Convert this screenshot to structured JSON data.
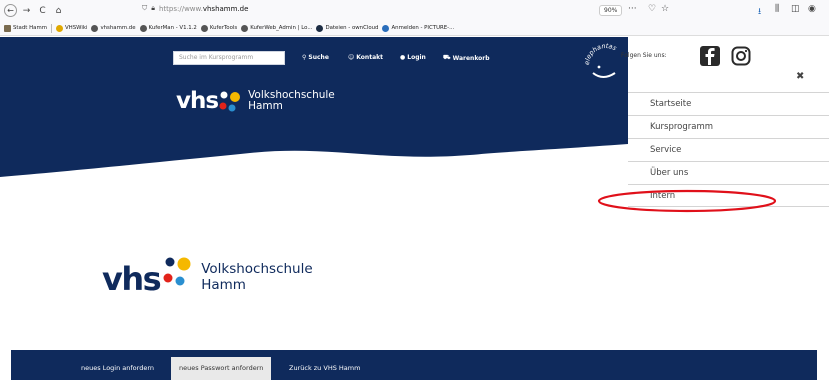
{
  "browser": {
    "url_prefix": "https://www.",
    "url_domain": "vhshamm.de",
    "zoom": "90%",
    "more": "···",
    "bookmarks": [
      {
        "label": "Stadt Hamm",
        "color": "#7a6b4f"
      },
      {
        "label": "VHSWiki",
        "color": "#e0a800"
      },
      {
        "label": "vhshamm.de",
        "color": "#555"
      },
      {
        "label": "KuferMan - V1.1.2",
        "color": "#555"
      },
      {
        "label": "KuferTools",
        "color": "#555"
      },
      {
        "label": "KuferWeb_Admin | Lo...",
        "color": "#555"
      },
      {
        "label": "Dateien - ownCloud",
        "color": "#1d2d44"
      },
      {
        "label": "Anmelden - PICTURE-...",
        "color": "#2a6ebb"
      }
    ]
  },
  "header": {
    "search_placeholder": "Suche im Kursprogramm",
    "nav": {
      "suche": "Suche",
      "kontakt": "Kontakt",
      "login": "Login",
      "warenkorb": "Warenkorb"
    },
    "logo_vhs": "vhs",
    "logo_line1": "Volkshochschule",
    "logo_line2": "Hamm",
    "elephant_text": "elephantas"
  },
  "panel": {
    "follow_label": "Folgen Sie uns:",
    "menu": [
      "Startseite",
      "Kursprogramm",
      "Service",
      "Über uns",
      "Intern"
    ]
  },
  "page_logo": {
    "vhs": "vhs",
    "line1": "Volkshochschule",
    "line2": "Hamm"
  },
  "footer": {
    "items": [
      "neues Login anfordern",
      "neues Passwort anfordern",
      "Zurück zu VHS Hamm"
    ]
  },
  "colors": {
    "navy": "#0f2a5c",
    "highlight": "#e0101a"
  }
}
